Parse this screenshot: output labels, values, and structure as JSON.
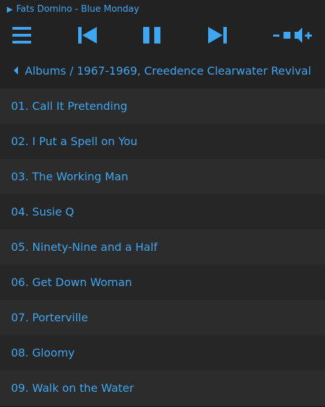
{
  "now_playing": {
    "play_icon": "play-icon",
    "text": "Fats Domino - Blue Monday"
  },
  "controls": {
    "menu_icon": "hamburger-menu-icon",
    "prev_icon": "skip-previous-icon",
    "pause_icon": "pause-icon",
    "next_icon": "skip-next-icon",
    "volume_down_icon": "volume-down-icon",
    "volume_up_icon": "volume-up-icon",
    "accent": "#3ea6f2"
  },
  "breadcrumb": {
    "back_icon": "caret-left-icon",
    "text": "Albums / 1967-1969, Creedence Clearwater Revival"
  },
  "tracks": [
    {
      "label": "01. Call It Pretending"
    },
    {
      "label": "02. I Put a Spell on You"
    },
    {
      "label": "03. The Working Man"
    },
    {
      "label": "04. Susie Q"
    },
    {
      "label": "05. Ninety-Nine and a Half"
    },
    {
      "label": "06. Get Down Woman"
    },
    {
      "label": "07. Porterville"
    },
    {
      "label": "08. Gloomy"
    },
    {
      "label": "09. Walk on the Water"
    }
  ],
  "colors": {
    "background": "#222222",
    "row_a": "#2c2c2c",
    "row_b": "#262626",
    "text": "#3ea6f2"
  }
}
